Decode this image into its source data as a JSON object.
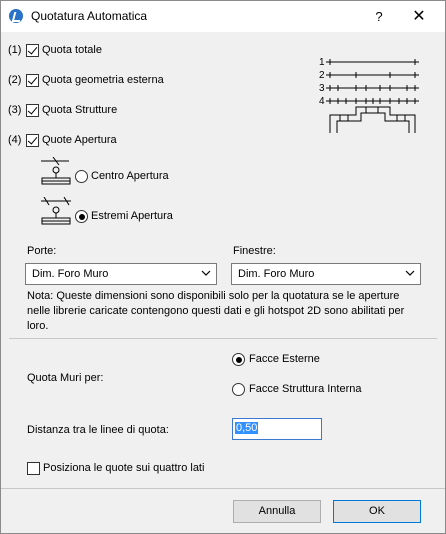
{
  "window": {
    "title": "Quotatura Automatica",
    "help": "?",
    "close": "✕"
  },
  "options": [
    {
      "num": "(1)",
      "label": "Quota totale",
      "checked": true
    },
    {
      "num": "(2)",
      "label": "Quota geometria esterna",
      "checked": true
    },
    {
      "num": "(3)",
      "label": "Quota Strutture",
      "checked": true
    },
    {
      "num": "(4)",
      "label": "Quote Apertura",
      "checked": true
    }
  ],
  "preview_levels": [
    "1",
    "2",
    "3",
    "4"
  ],
  "apertura": {
    "centro": "Centro Apertura",
    "estremi": "Estremi Apertura",
    "selected": "estremi"
  },
  "porte": {
    "label": "Porte:",
    "value": "Dim. Foro Muro"
  },
  "finestre": {
    "label": "Finestre:",
    "value": "Dim. Foro Muro"
  },
  "note": "Nota: Queste dimensioni sono disponibili solo per la quotatura se le aperture nelle librerie caricate contengono questi dati e gli hotspot 2D sono abilitati per loro.",
  "quota_muri": {
    "label": "Quota Muri per:",
    "option1": "Facce Esterne",
    "option2": "Facce Struttura Interna",
    "selected": "option1"
  },
  "distanza": {
    "label": "Distanza tra le linee di quota:",
    "value": "0,50"
  },
  "quattro_lati": {
    "label": "Posiziona le quote sui quattro lati",
    "checked": false
  },
  "buttons": {
    "cancel": "Annulla",
    "ok": "OK"
  }
}
